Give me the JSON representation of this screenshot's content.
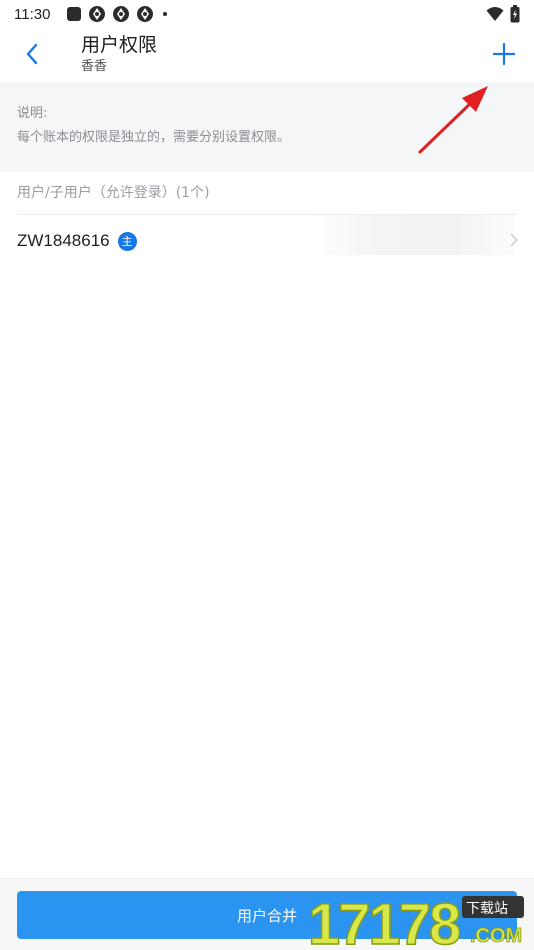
{
  "status_bar": {
    "time": "11:30",
    "icons": [
      "square-icon",
      "aperture-icon",
      "aperture-icon",
      "aperture-icon",
      "dot-icon"
    ],
    "right_icons": [
      "wifi-icon",
      "battery-icon"
    ]
  },
  "header": {
    "title": "用户权限",
    "subtitle": "香香",
    "back_icon": "chevron-left-icon",
    "add_icon": "plus-icon"
  },
  "notice": {
    "title": "说明:",
    "text": "每个账本的权限是独立的，需要分别设置权限。"
  },
  "section": {
    "header": "用户/子用户（允许登录）(1个)"
  },
  "users": [
    {
      "name": "ZW1848616",
      "badge": "主"
    }
  ],
  "footer": {
    "merge_label": "用户合并"
  },
  "watermark": {
    "text": "17178",
    "tag": "下载站",
    "suffix": ".COM"
  },
  "colors": {
    "accent": "#1677e6",
    "button": "#2b94f1",
    "annotation_arrow": "#e02020"
  }
}
